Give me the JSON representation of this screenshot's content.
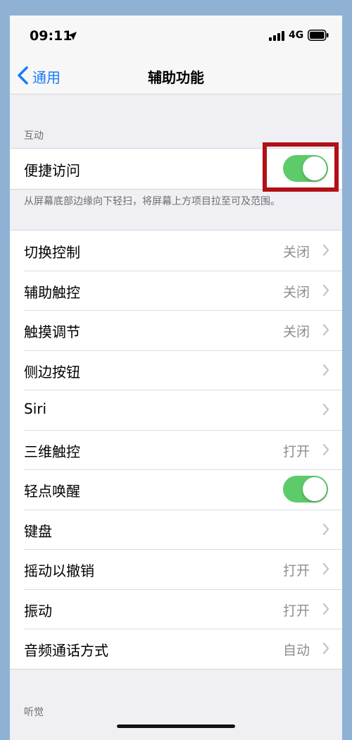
{
  "status": {
    "time": "09:11",
    "network": "4G"
  },
  "nav": {
    "back_label": "通用",
    "title": "辅助功能"
  },
  "sections": {
    "interaction_header": "互动",
    "hearing_header": "听觉"
  },
  "reachability": {
    "label": "便捷访问",
    "enabled": true,
    "footer": "从屏幕底部边缘向下轻扫，将屏幕上方项目拉至可及范围。"
  },
  "rows": [
    {
      "label": "切换控制",
      "value": "关闭"
    },
    {
      "label": "辅助触控",
      "value": "关闭"
    },
    {
      "label": "触摸调节",
      "value": "关闭"
    },
    {
      "label": "侧边按钮",
      "value": ""
    },
    {
      "label": "Siri",
      "value": ""
    },
    {
      "label": "三维触控",
      "value": "打开"
    },
    {
      "label": "轻点唤醒",
      "value": ""
    },
    {
      "label": "键盘",
      "value": ""
    },
    {
      "label": "摇动以撤销",
      "value": "打开"
    },
    {
      "label": "振动",
      "value": "打开"
    },
    {
      "label": "音频通话方式",
      "value": "自动"
    }
  ],
  "colors": {
    "accent": "#1a7cf5",
    "toggle_on": "#5ecb6b",
    "highlight": "#b01017"
  }
}
